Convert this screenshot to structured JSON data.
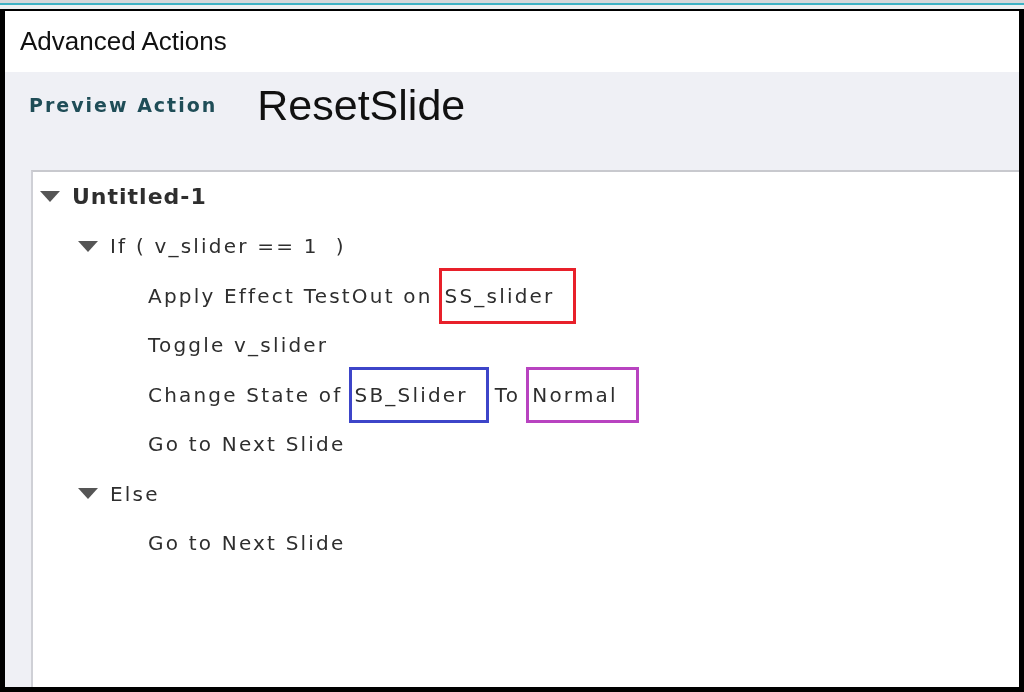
{
  "window": {
    "title": "Advanced Actions"
  },
  "header": {
    "label": "Preview Action",
    "action_name": "ResetSlide"
  },
  "tree": [
    {
      "parts": [
        {
          "text": "Untitled-1"
        }
      ],
      "expanded": true,
      "children": [
        {
          "parts": [
            {
              "text": "If ( v_slider == 1  )"
            }
          ],
          "expanded": true,
          "children": [
            {
              "parts": [
                {
                  "text": "Apply Effect TestOut on"
                },
                {
                  "text": "SS_slider",
                  "color": "#e8202a"
                }
              ]
            },
            {
              "parts": [
                {
                  "text": "Toggle v_slider"
                }
              ]
            },
            {
              "parts": [
                {
                  "text": "Change State of"
                },
                {
                  "text": "SB_Slider",
                  "color": "#3d45c9"
                },
                {
                  "text": "To"
                },
                {
                  "text": "Normal",
                  "color": "#b843c0"
                }
              ]
            },
            {
              "parts": [
                {
                  "text": "Go to Next Slide"
                }
              ]
            }
          ]
        },
        {
          "parts": [
            {
              "text": "Else"
            }
          ],
          "expanded": true,
          "children": [
            {
              "parts": [
                {
                  "text": "Go to Next Slide"
                }
              ]
            }
          ]
        }
      ]
    }
  ]
}
